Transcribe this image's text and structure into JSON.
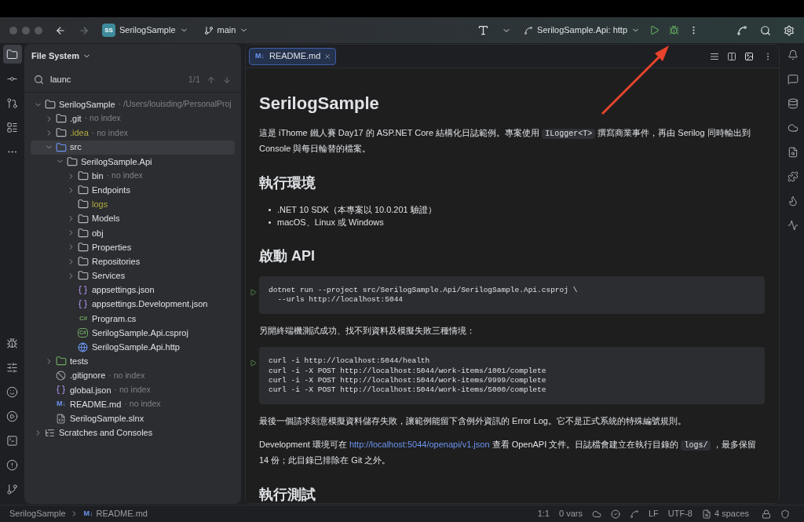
{
  "title_bar": {
    "project_badge": "SS",
    "project": "SerilogSample",
    "branch": "main",
    "run_config": "SerilogSample.Api: http"
  },
  "left_toolbar": {
    "top": [
      {
        "selected": true
      },
      {
        "selected": false
      },
      {
        "selected": false
      },
      {
        "selected": false
      },
      {
        "selected": false
      }
    ],
    "bottom": [
      {
        "selected": false
      },
      {
        "selected": false
      },
      {
        "selected": false
      },
      {
        "selected": false
      },
      {
        "selected": false
      },
      {
        "selected": false
      },
      {
        "selected": false
      }
    ]
  },
  "file_panel": {
    "title": "File System",
    "search": {
      "value": "launc",
      "count": "1/1"
    },
    "tree": [
      {
        "name": "SerilogSample",
        "kind": "project",
        "note": "· /Users/louisding/PersonalProj",
        "expanded": true,
        "selected": false,
        "ignored": false,
        "children": [
          {
            "name": ".git",
            "kind": "folder",
            "note": "· no index",
            "expanded": false,
            "selected": false,
            "ignored": false
          },
          {
            "name": ".idea",
            "kind": "folder",
            "note": "· no index",
            "expanded": false,
            "selected": false,
            "ignored": true
          },
          {
            "name": "src",
            "kind": "source",
            "expanded": true,
            "selected": true,
            "ignored": false,
            "children": [
              {
                "name": "SerilogSample.Api",
                "kind": "module",
                "expanded": true,
                "selected": false,
                "ignored": false,
                "children": [
                  {
                    "name": "bin",
                    "kind": "folder",
                    "note": "· no index",
                    "expanded": false,
                    "selected": false,
                    "ignored": false
                  },
                  {
                    "name": "Endpoints",
                    "kind": "folder",
                    "expanded": false,
                    "selected": false,
                    "ignored": false
                  },
                  {
                    "name": "logs",
                    "kind": "folder",
                    "selected": false,
                    "ignored": true
                  },
                  {
                    "name": "Models",
                    "kind": "folder",
                    "expanded": false,
                    "selected": false,
                    "ignored": false
                  },
                  {
                    "name": "obj",
                    "kind": "folder",
                    "expanded": false,
                    "selected": false,
                    "ignored": false
                  },
                  {
                    "name": "Properties",
                    "kind": "properties",
                    "expanded": false,
                    "selected": false,
                    "ignored": false
                  },
                  {
                    "name": "Repositories",
                    "kind": "folder",
                    "expanded": false,
                    "selected": false,
                    "ignored": false
                  },
                  {
                    "name": "Services",
                    "kind": "folder",
                    "expanded": false,
                    "selected": false,
                    "ignored": false
                  },
                  {
                    "name": "appsettings.json",
                    "kind": "json",
                    "selected": false,
                    "ignored": false
                  },
                  {
                    "name": "appsettings.Development.json",
                    "kind": "json",
                    "selected": false,
                    "ignored": false
                  },
                  {
                    "name": "Program.cs",
                    "kind": "cs",
                    "icon_text": "C#",
                    "selected": false,
                    "ignored": false
                  },
                  {
                    "name": "SerilogSample.Api.csproj",
                    "kind": "csproj",
                    "icon_text": "C#",
                    "selected": false,
                    "ignored": false
                  },
                  {
                    "name": "SerilogSample.Api.http",
                    "kind": "http",
                    "selected": false,
                    "ignored": false
                  }
                ]
              }
            ]
          },
          {
            "name": "tests",
            "kind": "test",
            "expanded": false,
            "selected": false,
            "ignored": false
          },
          {
            "name": ".gitignore",
            "kind": "gitignore",
            "note": "· no index",
            "selected": false,
            "ignored": false
          },
          {
            "name": "global.json",
            "kind": "json",
            "note": "· no index",
            "selected": false,
            "ignored": false
          },
          {
            "name": "README.md",
            "kind": "md",
            "icon_text": "M↓",
            "note": "· no index",
            "selected": false,
            "ignored": false
          },
          {
            "name": "SerilogSample.slnx",
            "kind": "sln",
            "selected": false,
            "ignored": false
          }
        ]
      },
      {
        "name": "Scratches and Consoles",
        "kind": "scratches",
        "expanded": false,
        "selected": false,
        "ignored": false
      }
    ]
  },
  "editor": {
    "tabs": [
      {
        "icon_text": "M↓",
        "label": "README.md",
        "selected": true
      }
    ],
    "blocks": [
      {
        "kind": "h1",
        "text": "SerilogSample"
      },
      {
        "kind": "p",
        "parts": [
          {
            "kind": "text",
            "text": "這是 iThome 鐵人賽 Day17 的 ASP.NET Core 結構化日誌範例。專案使用 "
          },
          {
            "kind": "code",
            "text": "ILogger<T>"
          },
          {
            "kind": "text",
            "text": " 撰寫商業事件，再由 Serilog 同時輸出到 Console 與每日輪替的檔案。"
          }
        ]
      },
      {
        "kind": "h2",
        "text": "執行環境"
      },
      {
        "kind": "ul",
        "items": [
          ".NET 10 SDK（本專案以 10.0.201 驗證）",
          "macOS、Linux 或 Windows"
        ]
      },
      {
        "kind": "h2",
        "text": "啟動 API"
      },
      {
        "kind": "code",
        "lines": [
          "dotnet run --project src/SerilogSample.Api/SerilogSample.Api.csproj \\",
          "  --urls http://localhost:5044"
        ]
      },
      {
        "kind": "p",
        "parts": [
          {
            "kind": "text",
            "text": "另開終端機測試成功、找不到資料及模擬失敗三種情境："
          }
        ]
      },
      {
        "kind": "code",
        "lines": [
          "curl -i http://localhost:5044/health",
          "curl -i -X POST http://localhost:5044/work-items/1001/complete",
          "curl -i -X POST http://localhost:5044/work-items/9999/complete",
          "curl -i -X POST http://localhost:5044/work-items/5000/complete"
        ]
      },
      {
        "kind": "p",
        "parts": [
          {
            "kind": "text",
            "text": "最後一個請求刻意模擬資料儲存失敗，讓範例能留下含例外資訊的 Error Log。它不是正式系統的特殊編號規則。"
          }
        ]
      },
      {
        "kind": "p",
        "parts": [
          {
            "kind": "text",
            "text": "Development 環境可在 "
          },
          {
            "kind": "link",
            "text": "http://localhost:5044/openapi/v1.json"
          },
          {
            "kind": "text",
            "text": " 查看 OpenAPI 文件。日誌檔會建立在執行目錄的 "
          },
          {
            "kind": "code",
            "text": "logs/"
          },
          {
            "kind": "text",
            "text": " ，最多保留 14 份；此目錄已排除在 Git 之外。"
          }
        ]
      },
      {
        "kind": "h2",
        "text": "執行測試"
      }
    ]
  },
  "status_bar": {
    "breadcrumbs": [
      {
        "text": "SerilogSample"
      },
      {
        "icon_text": "M↓",
        "text": "README.md"
      }
    ],
    "position": "1:1",
    "vars": "0 vars",
    "line_ending": "LF",
    "encoding": "UTF-8",
    "indent": "4 spaces"
  }
}
